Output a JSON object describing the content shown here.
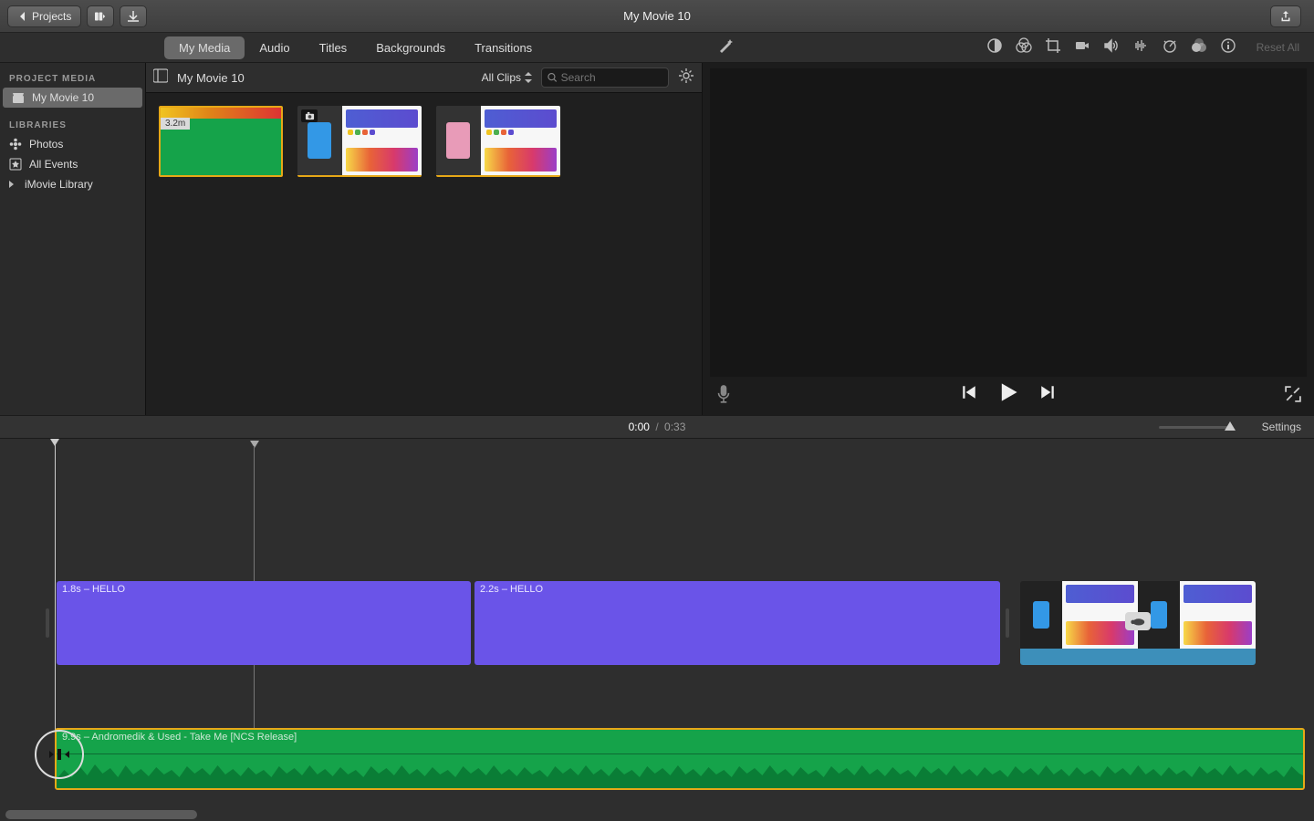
{
  "titlebar": {
    "back_label": "Projects",
    "title": "My Movie 10"
  },
  "tabs": {
    "items": [
      "My Media",
      "Audio",
      "Titles",
      "Backgrounds",
      "Transitions"
    ],
    "active_index": 0,
    "reset_all": "Reset All"
  },
  "sidebar": {
    "project_media_header": "PROJECT MEDIA",
    "project_name": "My Movie 10",
    "libraries_header": "LIBRARIES",
    "photos_label": "Photos",
    "all_events_label": "All Events",
    "imovie_library_label": "iMovie Library"
  },
  "browser": {
    "project_name": "My Movie 10",
    "filter_label": "All Clips",
    "search_placeholder": "Search",
    "thumbnails": [
      {
        "type": "audio",
        "duration": "3.2m"
      },
      {
        "type": "video"
      },
      {
        "type": "video"
      }
    ]
  },
  "time": {
    "current": "0:00",
    "separator": "/",
    "duration": "0:33",
    "settings_label": "Settings"
  },
  "timeline": {
    "title_clips": [
      {
        "label": "1.8s – HELLO"
      },
      {
        "label": "2.2s – HELLO"
      }
    ],
    "audio_clip": {
      "label": "9.9s – Andromedik & Used - Take Me [NCS Release]"
    }
  }
}
